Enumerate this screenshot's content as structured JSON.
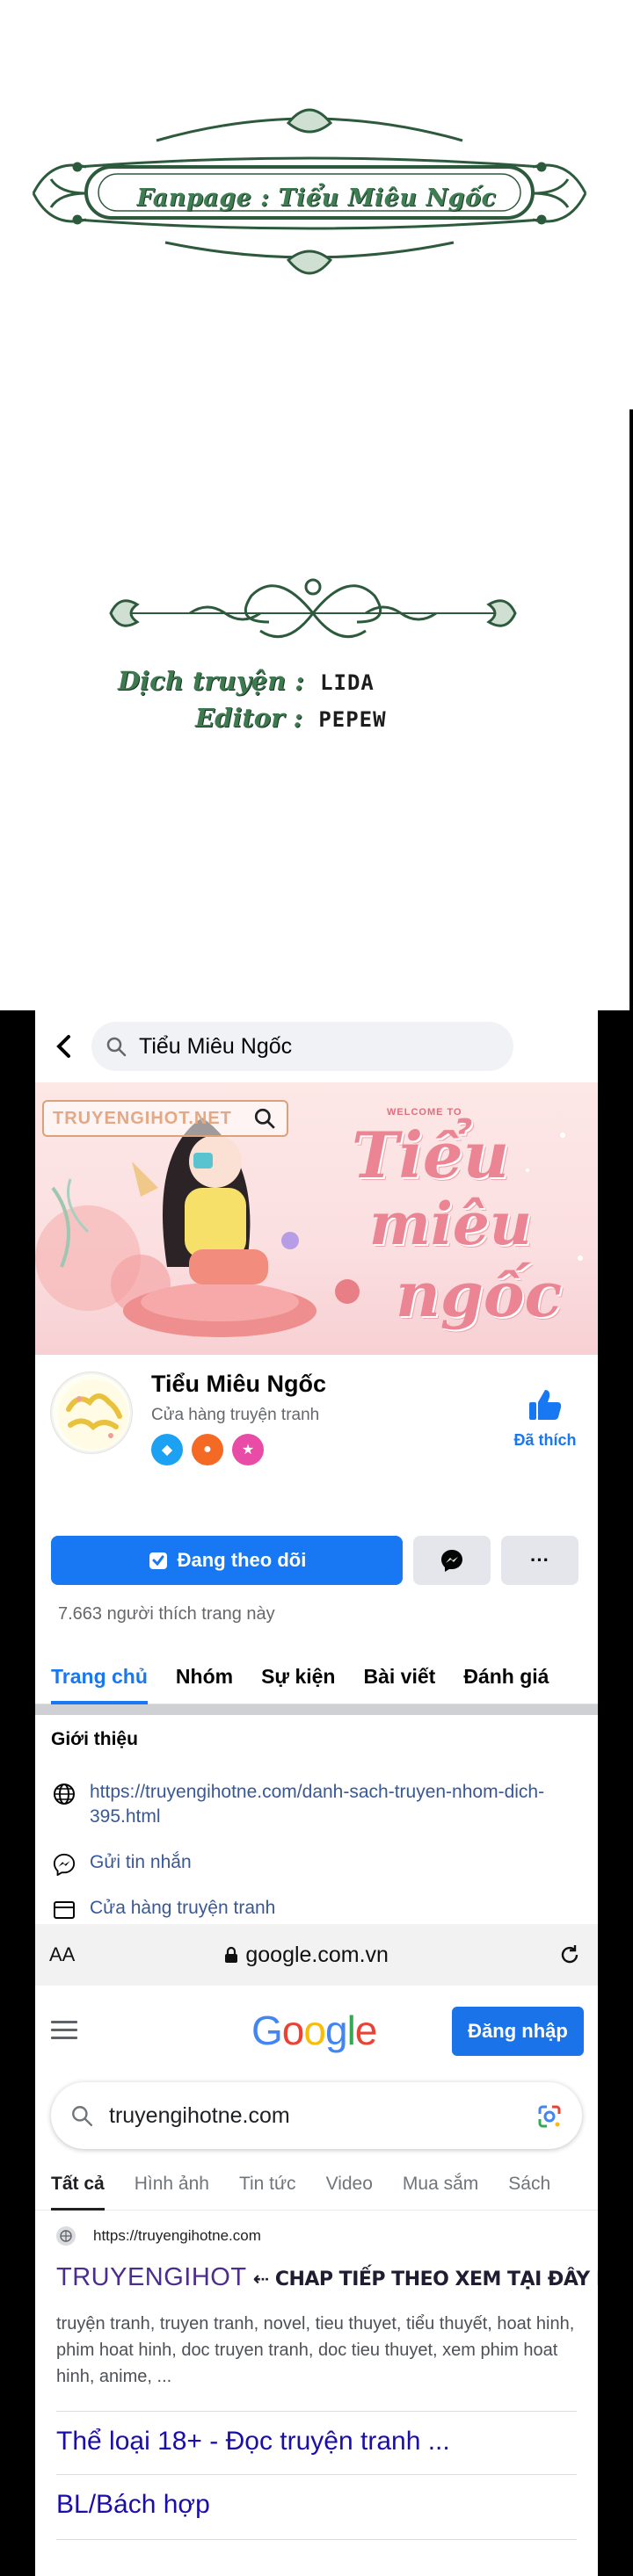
{
  "credits": {
    "fanpage": "Fanpage : Tiểu Miêu Ngốc",
    "translator_label": "Dịch truyện :",
    "translator_value": "LIDA",
    "editor_label": "Editor :",
    "editor_value": "PEPEW"
  },
  "facebook": {
    "search_query": "Tiểu Miêu Ngốc",
    "cover_watermark": "TRUYENGIHOT.NET",
    "cover_welcome": "WELCOME TO",
    "cover_script": [
      "Tiểu",
      "miêu",
      "ngốc"
    ],
    "page_name": "Tiểu Miêu Ngốc",
    "page_category": "Cửa hàng truyện tranh",
    "liked_label": "Đã thích",
    "following_button": "Đang theo dõi",
    "more_button": "···",
    "likes_count": "7.663 người thích trang này",
    "tabs": [
      "Trang chủ",
      "Nhóm",
      "Sự kiện",
      "Bài viết",
      "Đánh giá"
    ],
    "intro_title": "Giới thiệu",
    "intro_website": "https://truyengihotne.com/danh-sach-truyen-nhom-dich-395.html",
    "intro_message": "Gửi tin nhắn",
    "intro_category": "Cửa hàng truyện tranh"
  },
  "browser": {
    "text_size": "AA",
    "url": "google.com.vn"
  },
  "google": {
    "logo": [
      "G",
      "o",
      "o",
      "g",
      "l",
      "e"
    ],
    "logo_colors": [
      "#4285f4",
      "#ea4335",
      "#fbbc05",
      "#4285f4",
      "#34a853",
      "#ea4335"
    ],
    "signin": "Đăng nhập",
    "query": "truyengihotne.com",
    "tabs": [
      "Tất cả",
      "Hình ảnh",
      "Tin tức",
      "Video",
      "Mua sắm",
      "Sách"
    ],
    "result_site": "https://truyengihotne.com",
    "result_title_main": "TRUYENGIHOT",
    "result_title_rest": " ⇠ CHAP TIẾP THEO XEM TẠI ĐÂY NHA",
    "result_snippet": "truyện tranh, truyen tranh, novel, tieu thuyet, tiểu thuyết, hoat hinh, phim hoat hinh, doc truyen tranh, doc tieu thuyet, xem phim hoat hinh, anime, ...",
    "sub_link_1": "Thể loại 18+ - Đọc truyện tranh ...",
    "sub_link_2": "BL/Bách hợp"
  }
}
